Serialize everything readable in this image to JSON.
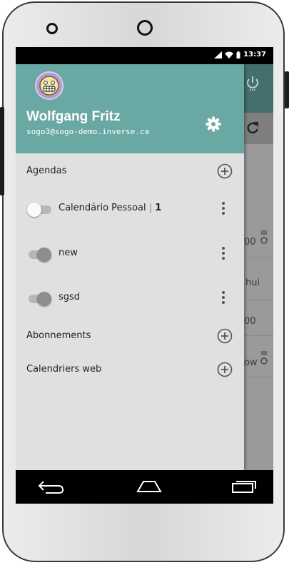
{
  "status_bar": {
    "time": "13:37"
  },
  "user": {
    "name": "Wolfgang Fritz",
    "email": "sogo3@sogo-demo.inverse.ca"
  },
  "sections": {
    "agendas": "Agendas",
    "subscriptions": "Abonnements",
    "web_calendars": "Calendriers web"
  },
  "calendars": [
    {
      "name": "Calendário Pessoal",
      "count": "1",
      "enabled": false
    },
    {
      "name": "new",
      "enabled": true
    },
    {
      "name": "sgsd",
      "enabled": true
    }
  ],
  "background_snippets": {
    "time_1": "00",
    "text_hui": "hui",
    "time_2": "00",
    "text_ow": "ow"
  }
}
